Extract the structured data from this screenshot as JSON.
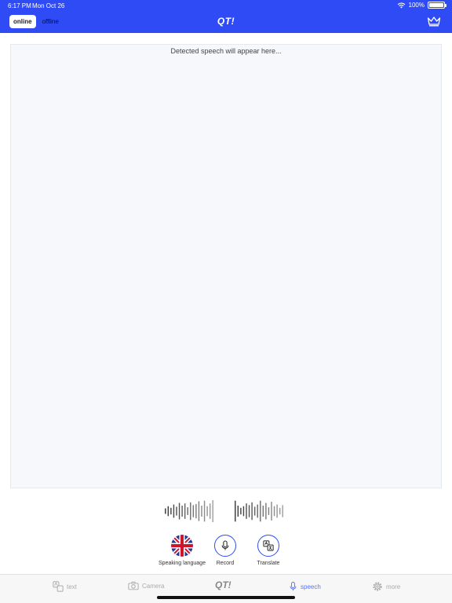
{
  "status_bar": {
    "time": "6:17 PM",
    "date": "Mon Oct 26",
    "battery": "100%"
  },
  "header": {
    "mode_online": "online",
    "mode_offline": "offline",
    "logo": "QT!",
    "crown_icon": "crown-icon"
  },
  "speech": {
    "placeholder": "Detected speech will appear here..."
  },
  "controls": {
    "speaking_language": "Speaking language",
    "record": "Record",
    "translate": "Translate"
  },
  "tabbar": {
    "text": "text",
    "camera": "Camera",
    "logo": "QT!",
    "speech": "speech",
    "more": "more"
  },
  "colors": {
    "brand": "#2f4bf5",
    "active_tab": "#5b74f5",
    "inactive_tab": "#aaaaaa"
  },
  "waveform": {
    "left": [
      0.25,
      0.45,
      0.3,
      0.6,
      0.4,
      0.75,
      0.5,
      0.7,
      0.35,
      0.8,
      0.55,
      0.65,
      0.9,
      0.5,
      0.95,
      0.45,
      0.7,
      1.0
    ],
    "right": [
      0.95,
      0.5,
      0.3,
      0.45,
      0.7,
      0.55,
      0.8,
      0.4,
      0.6,
      0.95,
      0.5,
      0.75,
      0.35,
      0.85,
      0.45,
      0.6,
      0.3,
      0.55
    ]
  }
}
